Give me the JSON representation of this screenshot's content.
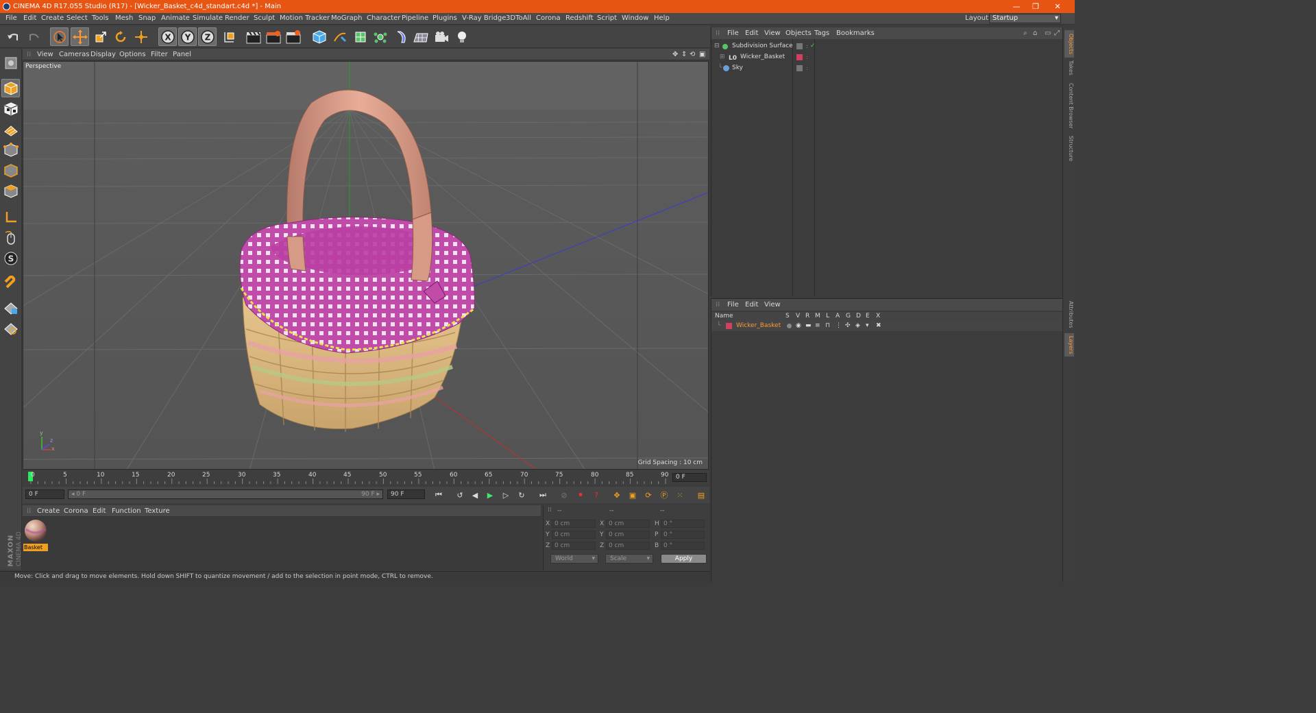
{
  "window": {
    "title": "CINEMA 4D R17.055 Studio (R17) - [Wicker_Basket_c4d_standart.c4d *] - Main",
    "controls": [
      "—",
      "❐",
      "✕"
    ]
  },
  "menubar": {
    "items": [
      "File",
      "Edit",
      "Create",
      "Select",
      "Tools",
      "Mesh",
      "Snap",
      "Animate",
      "Simulate",
      "Render",
      "Sculpt",
      "Motion Tracker",
      "MoGraph",
      "Character",
      "Pipeline",
      "Plugins",
      "V-Ray Bridge",
      "3DToAll",
      "Corona",
      "Redshift",
      "Script",
      "Window",
      "Help"
    ],
    "layout_label": "Layout:",
    "layout_value": "Startup"
  },
  "viewport": {
    "menu": [
      "View",
      "Cameras",
      "Display",
      "Options",
      "Filter",
      "Panel"
    ],
    "label": "Perspective",
    "grid_spacing": "Grid Spacing : 10 cm",
    "axis_x": "x",
    "axis_y": "y",
    "axis_z": "z"
  },
  "timeline": {
    "ticks": [
      "0",
      "5",
      "10",
      "15",
      "20",
      "25",
      "30",
      "35",
      "40",
      "45",
      "50",
      "55",
      "60",
      "65",
      "70",
      "75",
      "80",
      "85",
      "90"
    ],
    "current_frame": "0 F"
  },
  "transport": {
    "start_field": "0 F",
    "range_start": "◂ 0 F",
    "range_end": "90 F ▸",
    "end_field": "90 F"
  },
  "material": {
    "menu": [
      "Create",
      "Corona",
      "Edit",
      "Function",
      "Texture"
    ],
    "items": [
      {
        "name": "Basket"
      }
    ]
  },
  "coords": {
    "headers": [
      "--",
      "--",
      "--"
    ],
    "pos": [
      {
        "axis": "X",
        "value": "0 cm"
      },
      {
        "axis": "Y",
        "value": "0 cm"
      },
      {
        "axis": "Z",
        "value": "0 cm"
      }
    ],
    "size": [
      {
        "axis": "X",
        "value": "0 cm"
      },
      {
        "axis": "Y",
        "value": "0 cm"
      },
      {
        "axis": "Z",
        "value": "0 cm"
      }
    ],
    "rot": [
      {
        "axis": "H",
        "value": "0 °"
      },
      {
        "axis": "P",
        "value": "0 °"
      },
      {
        "axis": "B",
        "value": "0 °"
      }
    ],
    "mode1": "World",
    "mode2": "Scale",
    "apply": "Apply"
  },
  "status": {
    "text": "Move: Click and drag to move elements. Hold down SHIFT to quantize movement / add to the selection in point mode, CTRL to remove."
  },
  "logo": {
    "line1": "MAXON",
    "line2": "CINEMA 4D"
  },
  "objects": {
    "menu": [
      "File",
      "Edit",
      "View",
      "Objects",
      "Tags",
      "Bookmarks"
    ],
    "rows": [
      {
        "name": "Subdivision Surface",
        "color": "#58c46a"
      },
      {
        "name": "Wicker_Basket",
        "color": "#d24060"
      },
      {
        "name": "Sky",
        "color": "#6aa0d8"
      }
    ]
  },
  "layers": {
    "menu": [
      "File",
      "Edit",
      "View"
    ],
    "head_name": "Name",
    "columns": [
      "S",
      "V",
      "R",
      "M",
      "L",
      "A",
      "G",
      "D",
      "E",
      "X"
    ],
    "row": {
      "name": "Wicker_Basket",
      "color": "#d24060"
    }
  },
  "side_tabs": [
    "Objects",
    "Takes",
    "Content Browser",
    "Structure",
    "Attributes",
    "Layers"
  ],
  "colors": {
    "accent": "#e85412",
    "highlight": "#ff9a3a"
  }
}
